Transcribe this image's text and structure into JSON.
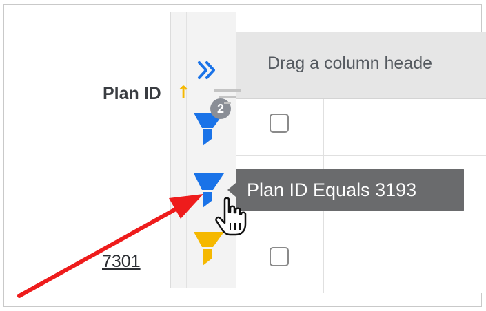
{
  "sidebar": {
    "expand_icon": "double-chevron-right-icon",
    "filters": [
      {
        "name": "filter-group-icon",
        "color": "#1a73e8",
        "count": "2"
      },
      {
        "name": "filter-icon",
        "color": "#1a73e8"
      },
      {
        "name": "filter-icon",
        "color": "#f5b800"
      }
    ]
  },
  "grid": {
    "group_panel_text": "Drag a column heade",
    "columns": [
      {
        "label": "Plan ID",
        "sort": "ascending",
        "sort_icon": "sort-ascending-arrow-icon",
        "filter_icon": "column-filter-icon"
      }
    ],
    "rows": [
      {
        "plan_id": ""
      },
      {
        "plan_id": "7301"
      }
    ]
  },
  "tooltip": {
    "text": "Plan ID Equals 3193"
  },
  "annotation": {
    "arrow_color": "#ee1c1c"
  },
  "colors": {
    "accent_blue": "#1a73e8",
    "accent_yellow": "#f5b800",
    "tooltip_bg": "#6a6b6d",
    "badge_bg": "#8a8e96"
  }
}
